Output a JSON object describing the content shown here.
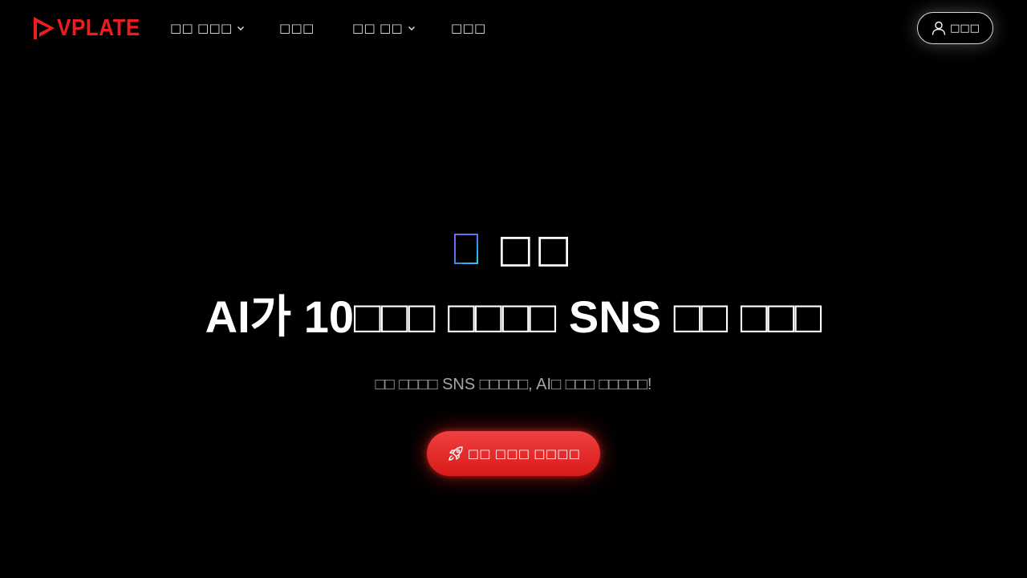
{
  "brand": {
    "logo_text": "VPLATE",
    "logo_color": "#ee1c1c",
    "logo_icon": "play-arrow-icon"
  },
  "nav": {
    "items": [
      {
        "label": "□□ □□□",
        "has_dropdown": true
      },
      {
        "label": "□□□",
        "has_dropdown": false
      },
      {
        "label": "□□ □□",
        "has_dropdown": true
      },
      {
        "label": "□□□",
        "has_dropdown": false
      }
    ]
  },
  "header": {
    "login_label": "□□□",
    "login_icon": "user-icon"
  },
  "hero": {
    "kicker_icon": "gradient-outline-icon",
    "kicker_text": "□□",
    "title": "AI가 10□□□ □□□□ SNS □□ □□□",
    "subtitle": "□□ □□□□ SNS □□□□□, AI□ □□□ □□□□□!",
    "cta_label": "□□ □□□ □□□□",
    "cta_icon": "rocket-icon"
  },
  "colors": {
    "background": "#000000",
    "accent": "#e52525",
    "subtitle_text": "#a6a6a6"
  }
}
